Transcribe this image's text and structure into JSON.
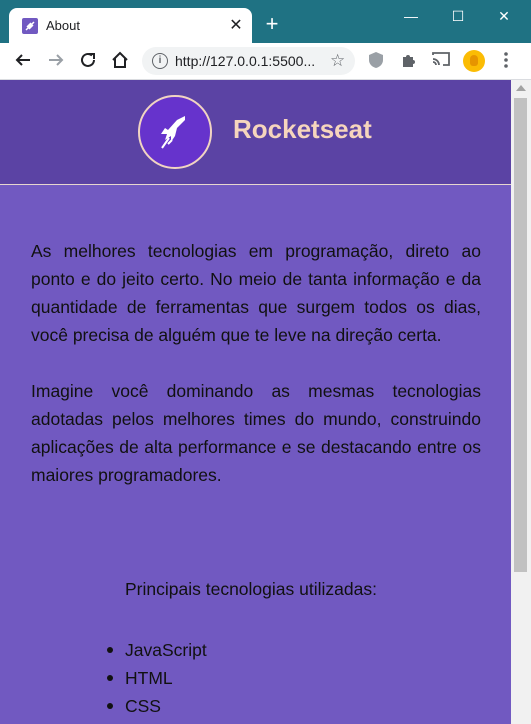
{
  "browser": {
    "tab_title": "About",
    "tab_close": "✕",
    "new_tab": "+",
    "url": "http://127.0.0.1:5500...",
    "window_controls": {
      "minimize": "—",
      "maximize": "☐",
      "close": "✕"
    },
    "icons": [
      "back-icon",
      "forward-icon",
      "reload-icon",
      "home-icon",
      "info-icon",
      "star-icon",
      "shield-extension-icon",
      "puzzle-extensions-icon",
      "cast-icon",
      "profile-avatar-icon",
      "kebab-menu-icon"
    ]
  },
  "page": {
    "brand": "Rocketseat",
    "paragraphs": [
      "As melhores tecnologias em programação, direto ao ponto e do jeito certo. No meio de tanta informação e da quantidade de ferramentas que surgem todos os dias, você precisa de alguém que te leve na direção certa.",
      "Imagine você dominando as mesmas tecnologias adotadas pelos melhores times do mundo, construindo aplicações de alta performance e se destacando entre os maiores programadores."
    ],
    "tech_title": "Principais tecnologias utilizadas:",
    "technologies": [
      "JavaScript",
      "HTML",
      "CSS"
    ],
    "colors": {
      "background": "#7159c1",
      "header": "#5b43a4",
      "brand_text": "#f6d5bd",
      "logo": "#6633cc"
    }
  }
}
